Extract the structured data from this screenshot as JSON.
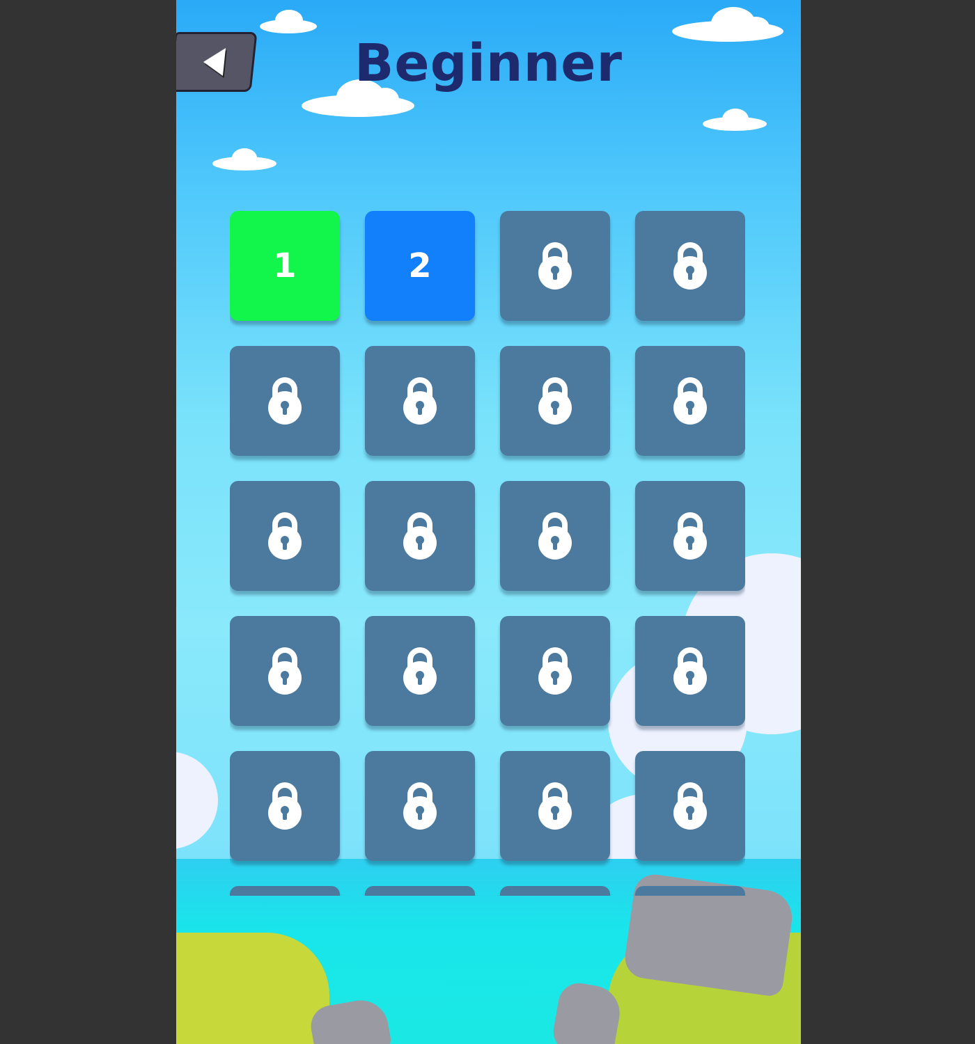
{
  "screen": {
    "title": "Beginner",
    "frame_color": "#333333"
  },
  "back_button": {
    "icon": "back-arrow-icon"
  },
  "levels": [
    {
      "label": "1",
      "state": "completed",
      "color": "#12f54a"
    },
    {
      "label": "2",
      "state": "current",
      "color": "#1280fb"
    },
    {
      "label": "",
      "state": "locked"
    },
    {
      "label": "",
      "state": "locked"
    },
    {
      "label": "",
      "state": "locked"
    },
    {
      "label": "",
      "state": "locked"
    },
    {
      "label": "",
      "state": "locked"
    },
    {
      "label": "",
      "state": "locked"
    },
    {
      "label": "",
      "state": "locked"
    },
    {
      "label": "",
      "state": "locked"
    },
    {
      "label": "",
      "state": "locked"
    },
    {
      "label": "",
      "state": "locked"
    },
    {
      "label": "",
      "state": "locked"
    },
    {
      "label": "",
      "state": "locked"
    },
    {
      "label": "",
      "state": "locked"
    },
    {
      "label": "",
      "state": "locked"
    },
    {
      "label": "",
      "state": "locked"
    },
    {
      "label": "",
      "state": "locked"
    },
    {
      "label": "",
      "state": "locked"
    },
    {
      "label": "",
      "state": "locked"
    },
    {
      "label": "",
      "state": "locked"
    },
    {
      "label": "",
      "state": "locked"
    },
    {
      "label": "",
      "state": "locked"
    },
    {
      "label": "",
      "state": "locked"
    }
  ],
  "locked_tile_color": "#4b7a9e",
  "lock_icon": "lock-icon"
}
